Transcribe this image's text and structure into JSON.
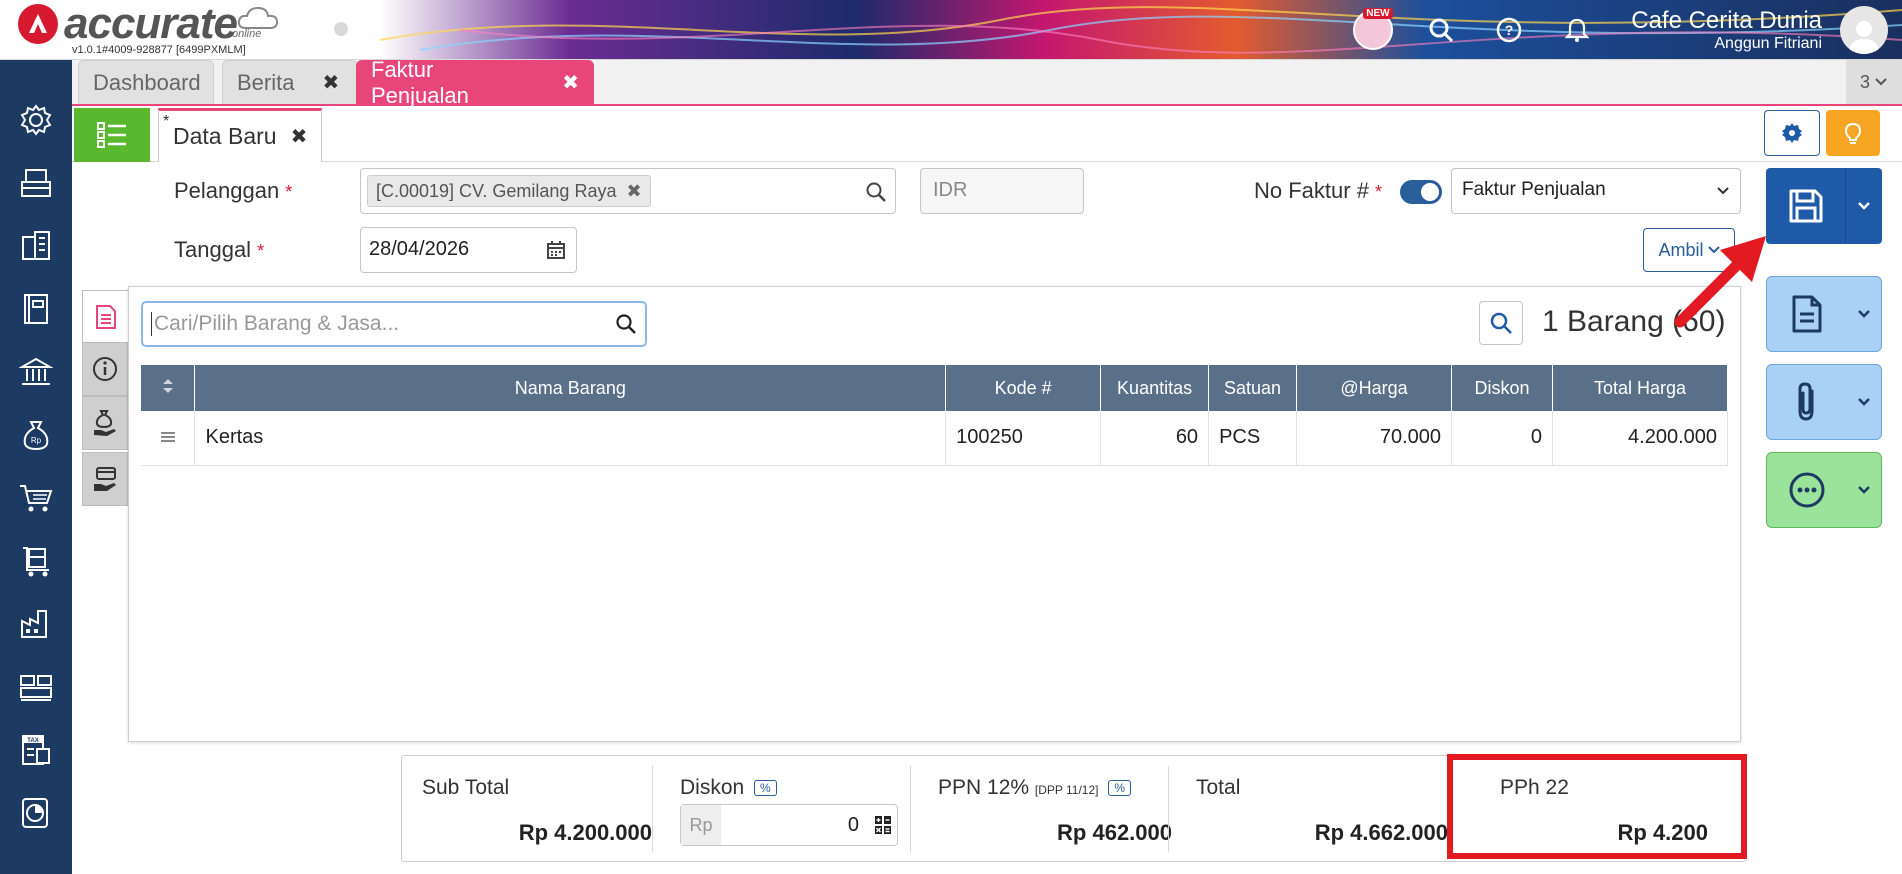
{
  "app": {
    "logo_text": "accurate",
    "logo_sub": "online",
    "version": "v1.0.1#4009-928877 [6499PXMLM]",
    "new_badge": "NEW",
    "company_name": "Cafe Cerita Dunia",
    "user_name": "Anggun Fitriani"
  },
  "sidebar": {
    "items": [
      "gear-icon",
      "inventory-box-icon",
      "building-icon",
      "ledger-book-icon",
      "bank-icon",
      "money-bag-icon",
      "shopping-cart-icon",
      "delivery-cart-icon",
      "factory-icon",
      "warehouse-icon",
      "tax-report-icon",
      "pie-chart-icon"
    ]
  },
  "tabs": {
    "items": [
      {
        "label": "Dashboard",
        "closable": false
      },
      {
        "label": "Berita",
        "closable": true
      },
      {
        "label": "Faktur Penjualan",
        "closable": true,
        "active": true
      }
    ],
    "count": "3"
  },
  "subheader": {
    "doc_tab_label": "Data Baru",
    "doc_tab_marker": "*"
  },
  "form": {
    "pelanggan_label": "Pelanggan",
    "pelanggan_value": "[C.00019] CV. Gemilang Raya",
    "currency": "IDR",
    "no_faktur_label": "No Faktur #",
    "doc_type": "Faktur Penjualan",
    "tanggal_label": "Tanggal",
    "tanggal_value": "28/04/2026",
    "ambil_label": "Ambil",
    "required_mark": "*"
  },
  "detail": {
    "search_placeholder": "Cari/Pilih Barang & Jasa...",
    "item_count": "1 Barang (60)",
    "columns": [
      "Nama Barang",
      "Kode #",
      "Kuantitas",
      "Satuan",
      "@Harga",
      "Diskon",
      "Total Harga"
    ],
    "rows": [
      {
        "nama": "Kertas",
        "kode": "100250",
        "qty": "60",
        "satuan": "PCS",
        "harga": "70.000",
        "diskon": "0",
        "total": "4.200.000"
      }
    ]
  },
  "summary": {
    "subtotal_label": "Sub Total",
    "subtotal_value": "Rp 4.200.000",
    "diskon_label": "Diskon",
    "pct_label": "%",
    "diskon_currency": "Rp",
    "diskon_value": "0",
    "ppn_label": "PPN 12%",
    "ppn_dpp": "[DPP 11/12]",
    "ppn_value": "Rp 462.000",
    "total_label": "Total",
    "total_value": "Rp 4.662.000",
    "pph_label": "PPh 22",
    "pph_value": "Rp 4.200"
  },
  "colors": {
    "sidebar": "#1d3a63",
    "accent_pink": "#e8457a",
    "primary_blue": "#1f5aa8",
    "highlight_red": "#e21b23"
  }
}
